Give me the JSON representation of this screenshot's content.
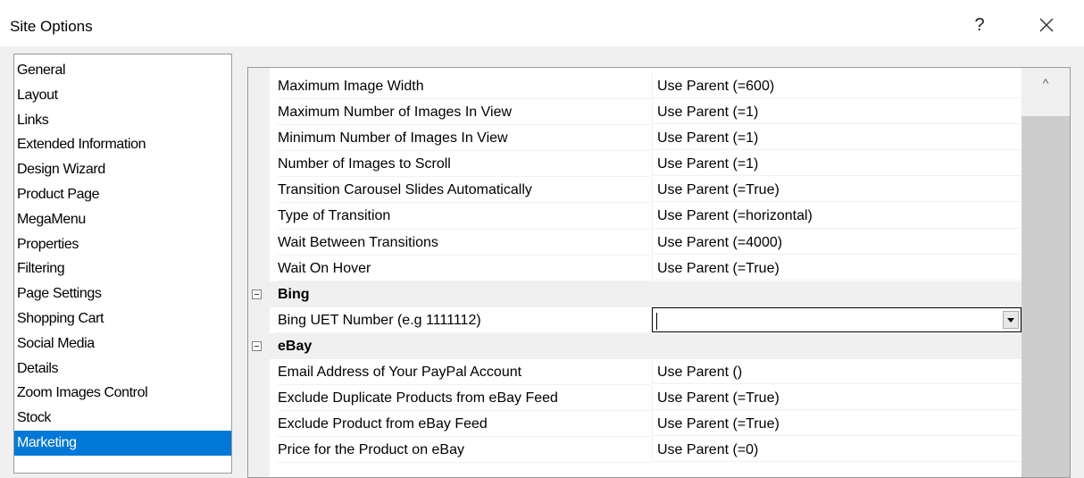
{
  "window": {
    "title": "Site Options",
    "help_label": "?"
  },
  "nav": {
    "items": [
      {
        "label": "General"
      },
      {
        "label": "Layout"
      },
      {
        "label": "Links"
      },
      {
        "label": "Extended Information"
      },
      {
        "label": "Design Wizard"
      },
      {
        "label": "Product Page"
      },
      {
        "label": "MegaMenu"
      },
      {
        "label": "Properties"
      },
      {
        "label": "Filtering"
      },
      {
        "label": "Page Settings"
      },
      {
        "label": "Shopping Cart"
      },
      {
        "label": "Social Media"
      },
      {
        "label": "Details"
      },
      {
        "label": "Zoom Images Control"
      },
      {
        "label": "Stock"
      },
      {
        "label": "Marketing",
        "selected": true
      }
    ]
  },
  "grid": {
    "rows": [
      {
        "name": "Maximum Image Width",
        "value": "Use Parent (=600)"
      },
      {
        "name": "Maximum Number of Images In View",
        "value": "Use Parent (=1)"
      },
      {
        "name": "Minimum Number of Images In View",
        "value": "Use Parent (=1)"
      },
      {
        "name": "Number of Images to Scroll",
        "value": "Use Parent (=1)"
      },
      {
        "name": "Transition Carousel Slides Automatically",
        "value": "Use Parent (=True)"
      },
      {
        "name": "Type of Transition",
        "value": "Use Parent (=horizontal)"
      },
      {
        "name": "Wait Between Transitions",
        "value": "Use Parent (=4000)"
      },
      {
        "name": "Wait On Hover",
        "value": "Use Parent (=True)"
      },
      {
        "category": "Bing"
      },
      {
        "name": "Bing UET Number (e.g 1111112)",
        "value": "",
        "editing": true
      },
      {
        "category": "eBay"
      },
      {
        "name": "Email Address of Your PayPal Account",
        "value": "Use Parent ()"
      },
      {
        "name": "Exclude Duplicate Products from eBay Feed",
        "value": "Use Parent (=True)"
      },
      {
        "name": "Exclude Product from eBay Feed",
        "value": "Use Parent (=True)"
      },
      {
        "name": "Price for the Product on eBay",
        "value": "Use Parent (=0)"
      }
    ],
    "scroll_up_glyph": "^"
  },
  "icons": {
    "close": "close-icon",
    "collapse": "collapse-icon",
    "dropdown": "chevron-down-icon"
  }
}
